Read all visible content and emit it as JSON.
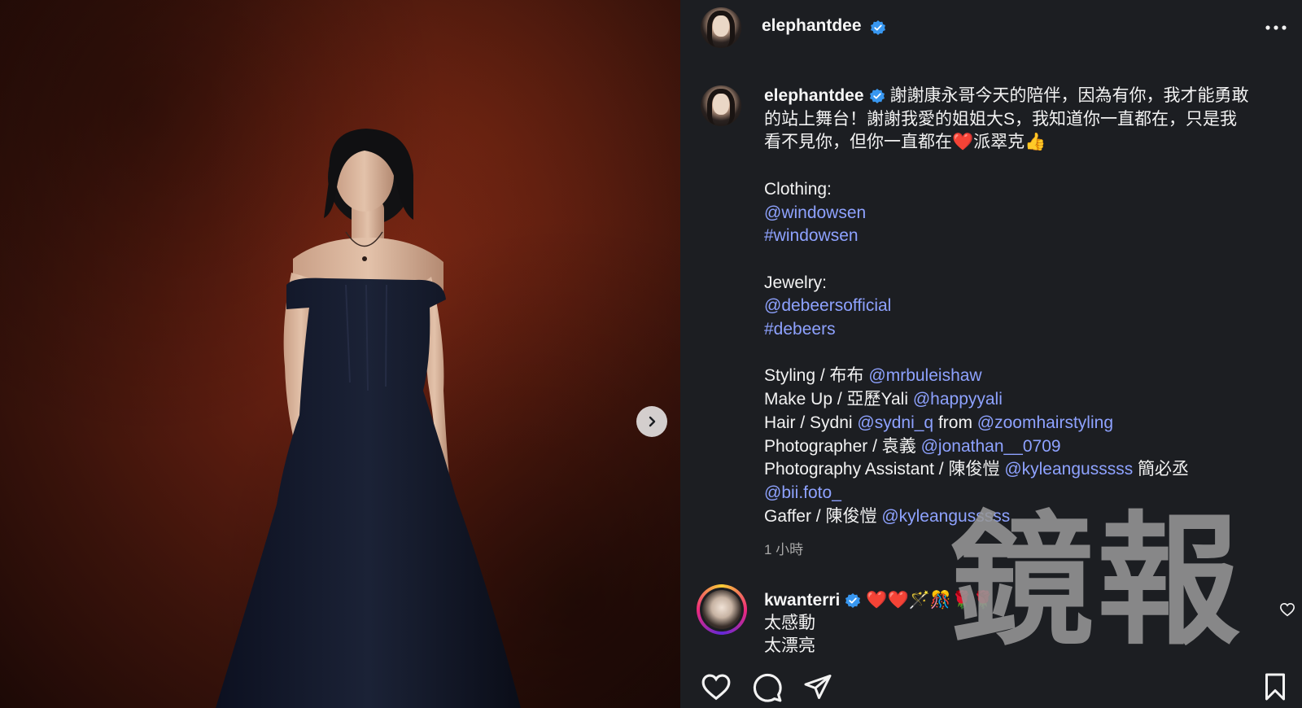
{
  "post": {
    "username": "elephantdee",
    "verified": true,
    "more_label": "•••",
    "caption": {
      "line1": "謝謝康永哥今天的陪伴，因為有你，我才能勇敢",
      "line2": "的站上舞台！謝謝我愛的姐姐大S，我知道你一直都在，只是我",
      "line3": "看不見你，但你一直都在❤️派翠克👍",
      "clothing_label": "Clothing:",
      "clothing_mention": "@windowsen",
      "clothing_hashtag": "#windowsen",
      "jewelry_label": "Jewelry:",
      "jewelry_mention": "@debeersofficial",
      "jewelry_hashtag": "#debeers",
      "styling_label": "Styling / 布布",
      "styling_mention": "@mrbuleishaw",
      "makeup_label": "Make Up / 亞歷Yali",
      "makeup_mention": "@happyyali",
      "hair_label": "Hair / Sydni",
      "hair_mention": "@sydni_q",
      "hair_from": "from",
      "hair_mention2": "@zoomhairstyling",
      "photographer_label": "Photographer / 袁義",
      "photographer_mention": "@jonathan__0709",
      "assistant_label": "Photography Assistant / 陳俊愷",
      "assistant_mention": "@kyleangusssss",
      "assistant_extra": "簡必丞",
      "assistant_mention2": "@bii.foto_",
      "gaffer_label": "Gaffer / 陳俊愷",
      "gaffer_mention": "@kyleangusssss"
    },
    "timestamp": "1 小時"
  },
  "comment": {
    "username": "kwanterri",
    "verified": true,
    "text_inline": "❤️❤️🪄🎊🌹🌹",
    "line2": "太感動",
    "line3": "太漂亮"
  },
  "watermark": "鏡報",
  "colors": {
    "background": "#1c1e22",
    "link": "#8ea2ff",
    "verified": "#3897f0",
    "text": "#f2f2f2",
    "muted": "#a8a8a8"
  },
  "icons": {
    "next": "chevron-right-icon",
    "more": "more-horizontal-icon",
    "like": "heart-icon",
    "comment": "speech-bubble-icon",
    "share": "paper-plane-icon",
    "save": "bookmark-icon",
    "verified": "verified-badge-icon"
  }
}
